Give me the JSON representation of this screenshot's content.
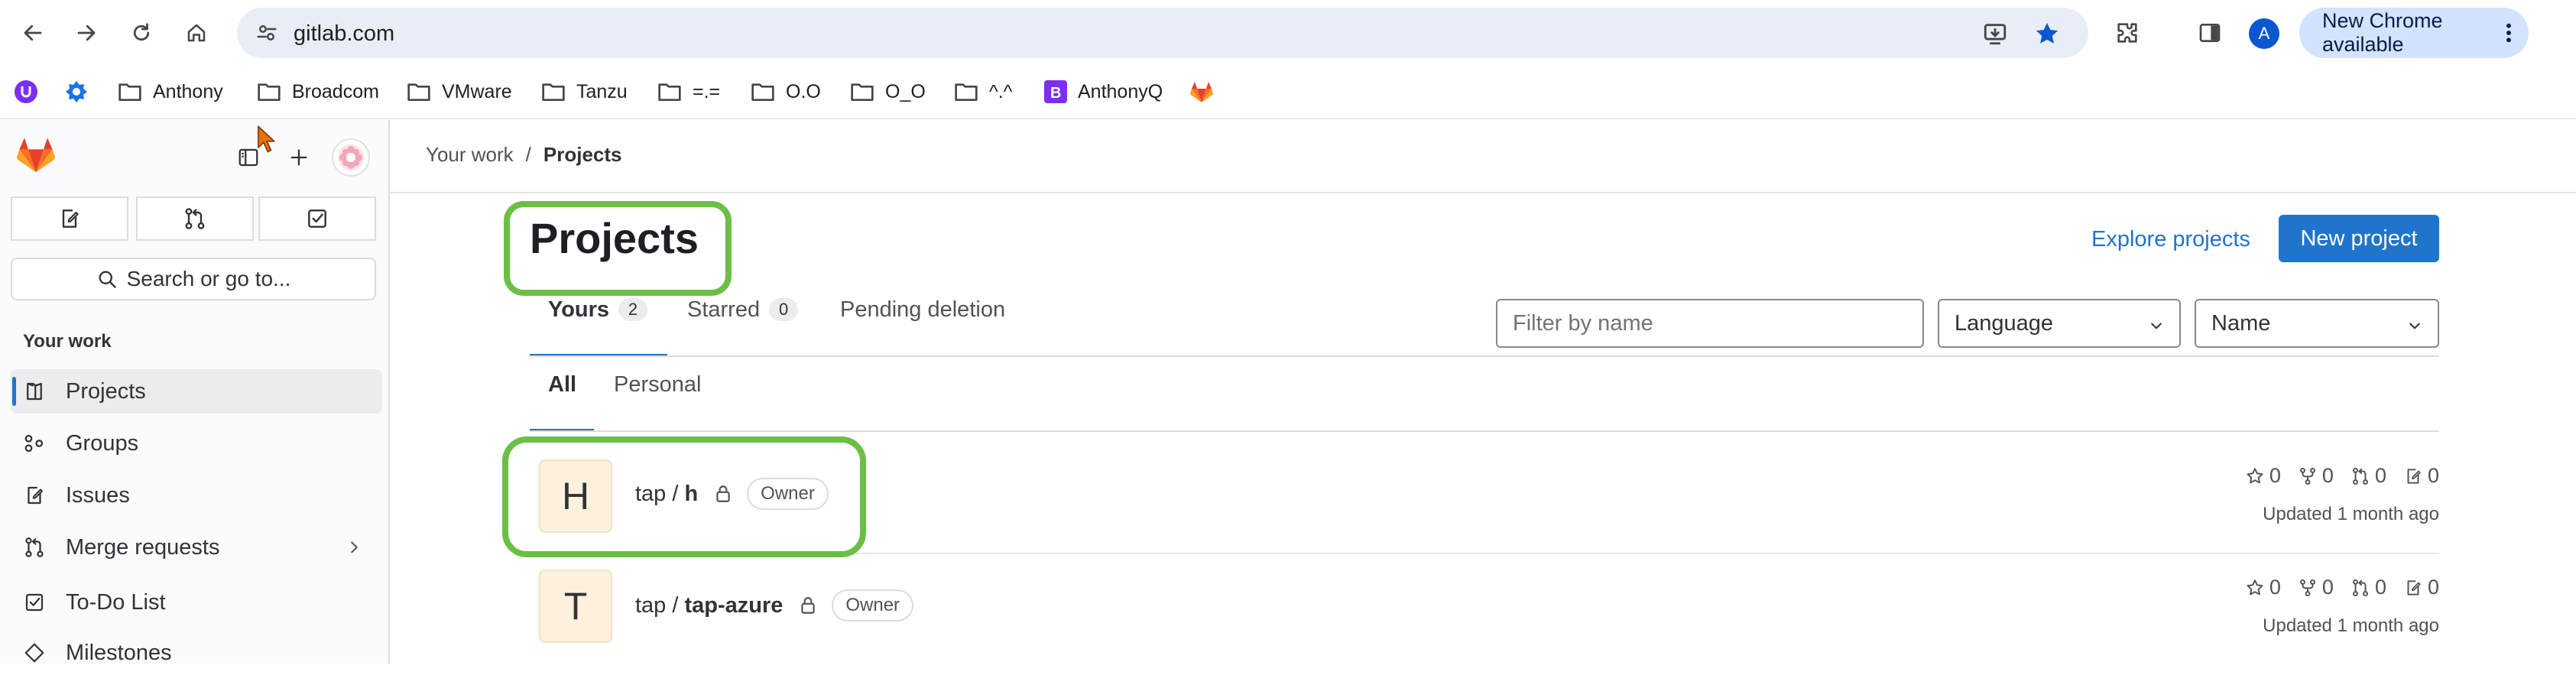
{
  "browser": {
    "url": "gitlab.com",
    "profile_initial": "A",
    "update_label": "New Chrome available"
  },
  "bookmarks": [
    {
      "label": "",
      "icon": "purple-u-icon"
    },
    {
      "label": "",
      "icon": "blue-badge-icon"
    },
    {
      "label": "Anthony",
      "icon": "folder-icon"
    },
    {
      "label": "Broadcom",
      "icon": "folder-icon"
    },
    {
      "label": "VMware",
      "icon": "folder-icon"
    },
    {
      "label": "Tanzu",
      "icon": "folder-icon"
    },
    {
      "label": "=.=",
      "icon": "folder-icon"
    },
    {
      "label": "O.O",
      "icon": "folder-icon"
    },
    {
      "label": "O_O",
      "icon": "folder-icon"
    },
    {
      "label": "^.^",
      "icon": "folder-icon"
    },
    {
      "label": "AnthonyQ",
      "icon": "purple-b-icon"
    },
    {
      "label": "",
      "icon": "gitlab-icon"
    }
  ],
  "sidebar": {
    "search_label": "Search or go to...",
    "section_title": "Your work",
    "items": [
      {
        "label": "Projects",
        "icon": "project-icon",
        "active": true
      },
      {
        "label": "Groups",
        "icon": "group-icon"
      },
      {
        "label": "Issues",
        "icon": "issues-icon"
      },
      {
        "label": "Merge requests",
        "icon": "merge-request-icon"
      },
      {
        "label": "To-Do List",
        "icon": "todo-icon"
      },
      {
        "label": "Milestones",
        "icon": "milestone-icon"
      }
    ]
  },
  "breadcrumb": {
    "parent": "Your work",
    "separator": "/",
    "current": "Projects"
  },
  "page": {
    "title": "Projects",
    "explore_label": "Explore projects",
    "new_project_label": "New project"
  },
  "tabs": [
    {
      "label": "Yours",
      "count": "2",
      "active": true
    },
    {
      "label": "Starred",
      "count": "0"
    },
    {
      "label": "Pending deletion",
      "count": ""
    }
  ],
  "subtabs": [
    {
      "label": "All",
      "active": true
    },
    {
      "label": "Personal"
    }
  ],
  "filters": {
    "name_placeholder": "Filter by name",
    "language": "Language",
    "sort": "Name"
  },
  "projects": [
    {
      "initial": "H",
      "namespace": "tap / ",
      "name": "h",
      "role": "Owner",
      "stars": "0",
      "forks": "0",
      "merge_requests": "0",
      "issues": "0",
      "updated": "Updated 1 month ago"
    },
    {
      "initial": "T",
      "namespace": "tap / ",
      "name": "tap-azure",
      "role": "Owner",
      "stars": "0",
      "forks": "0",
      "merge_requests": "0",
      "issues": "0",
      "updated": "Updated 1 month ago"
    }
  ],
  "colors": {
    "accent": "#1f75cb",
    "highlight": "#6bbf45",
    "gitlab_orange": "#e24329"
  }
}
